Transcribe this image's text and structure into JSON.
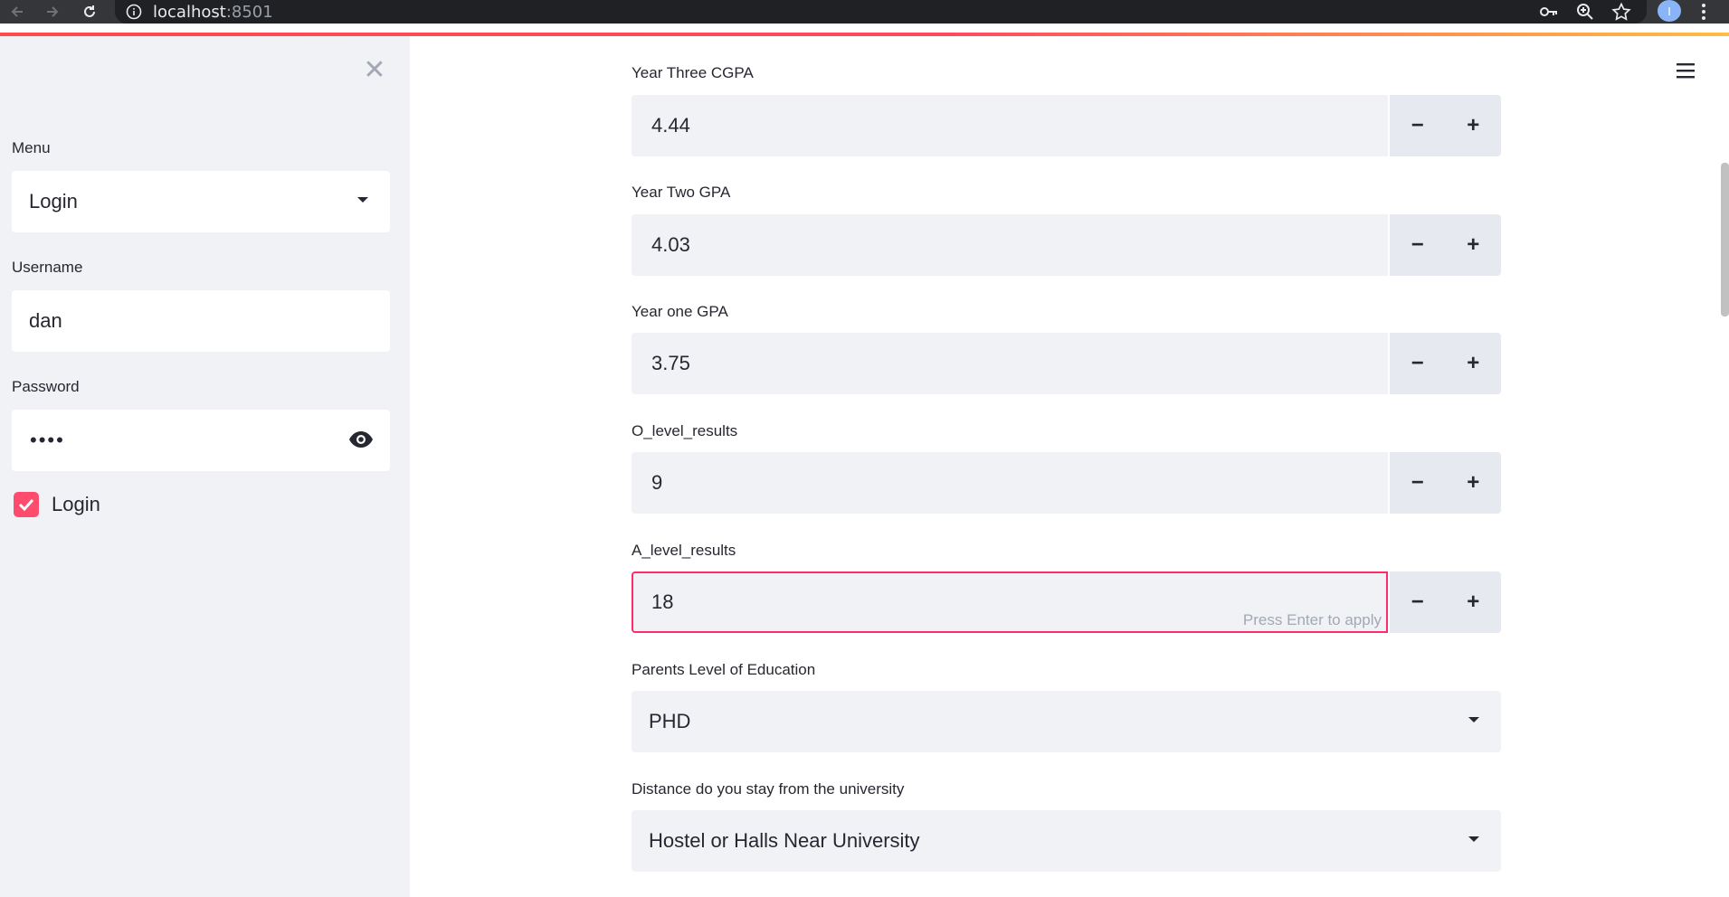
{
  "browser": {
    "url_host": "localhost",
    "url_port": ":8501",
    "profile_initial": "I"
  },
  "sidebar": {
    "menu": {
      "label": "Menu",
      "value": "Login"
    },
    "username": {
      "label": "Username",
      "value": "dan"
    },
    "password": {
      "label": "Password",
      "value": "••••"
    },
    "login_checkbox": {
      "label": "Login",
      "checked": true
    }
  },
  "main": {
    "year_three_cgpa": {
      "label": "Year Three CGPA",
      "value": "4.44"
    },
    "year_two_gpa": {
      "label": "Year Two GPA",
      "value": "4.03"
    },
    "year_one_gpa": {
      "label": "Year one GPA",
      "value": "3.75"
    },
    "o_level_results": {
      "label": "O_level_results",
      "value": "9"
    },
    "a_level_results": {
      "label": "A_level_results",
      "value": "18",
      "hint": "Press Enter to apply"
    },
    "parents_education": {
      "label": "Parents Level of Education",
      "value": "PHD"
    },
    "distance": {
      "label": "Distance do you stay from the university",
      "value": "Hostel or Halls Near University"
    },
    "stepper": {
      "minus": "−",
      "plus": "+"
    }
  },
  "colors": {
    "accent": "#ff4b6e",
    "sidebar_bg": "#f0f2f6",
    "input_bg": "#f0f2f6",
    "focus_border": "#ff2b6b"
  }
}
